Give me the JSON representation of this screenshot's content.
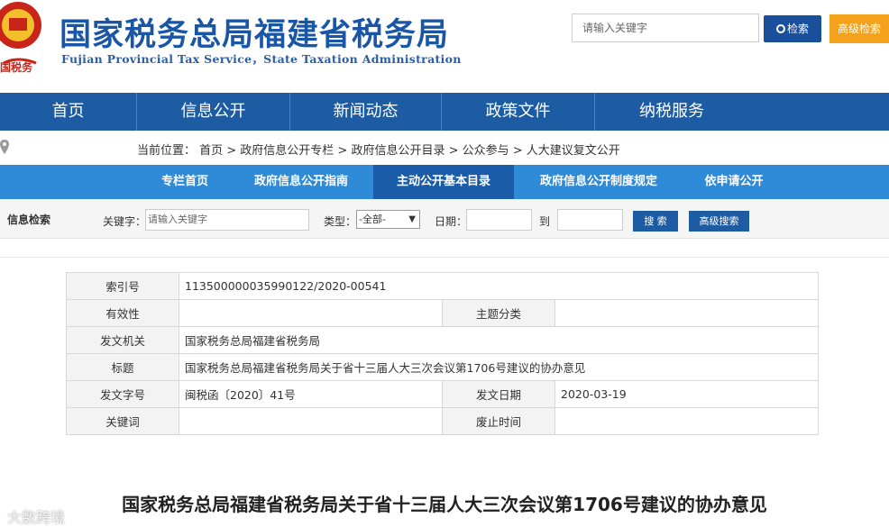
{
  "header": {
    "title": "国家税务总局福建省税务局",
    "subtitle": "Fujian Provincial Tax Service，State Taxation Administration",
    "search_placeholder": "请输入关键字",
    "search_button": "检索",
    "advanced_button": "高级检索",
    "emblem_text": "国税务"
  },
  "nav": {
    "items": [
      "首页",
      "信息公开",
      "新闻动态",
      "政策文件",
      "纳税服务"
    ]
  },
  "breadcrumb": {
    "text": "当前位置： 首页 > 政府信息公开专栏 > 政府信息公开目录 > 公众参与 > 人大建议复文公开"
  },
  "subnav": {
    "items": [
      "专栏首页",
      "政府信息公开指南",
      "主动公开基本目录",
      "政府信息公开制度规定",
      "依申请公开"
    ],
    "active_index": 2
  },
  "filter": {
    "title": "信息检索",
    "keyword_label": "关键字：",
    "keyword_placeholder": "请输入关键字",
    "type_label": "类型：",
    "type_selected": "-全部-",
    "date_label": "日期：",
    "date_to": "到",
    "search_button": "搜 索",
    "advanced_button": "高级搜索"
  },
  "meta": {
    "index_label": "索引号",
    "index_value": "11350000003599012​2/2020-00541",
    "validity_label": "有效性",
    "validity_value": "",
    "topic_label": "主题分类",
    "topic_value": "",
    "issuer_label": "发文机关",
    "issuer_value": "国家税务总局福建省税务局",
    "title_label": "标题",
    "title_value": "国家税务总局福建省税务局关于省十三届人大三次会议第1706号建议的协办意见",
    "docno_label": "发文字号",
    "docno_value": "闽税函〔2020〕41号",
    "date_label": "发文日期",
    "date_value": "2020-03-19",
    "keywords_label": "关键词",
    "keywords_value": "",
    "expiry_label": "废止时间",
    "expiry_value": ""
  },
  "document": {
    "title": "国家税务总局福建省税务局关于省十三届人大三次会议第1706号建议的协办意见"
  },
  "watermark": "大数跨境",
  "colors": {
    "brand_blue": "#1d5ba3",
    "subnav_blue": "#2f8ad8",
    "accent_orange": "#f4a21c"
  }
}
